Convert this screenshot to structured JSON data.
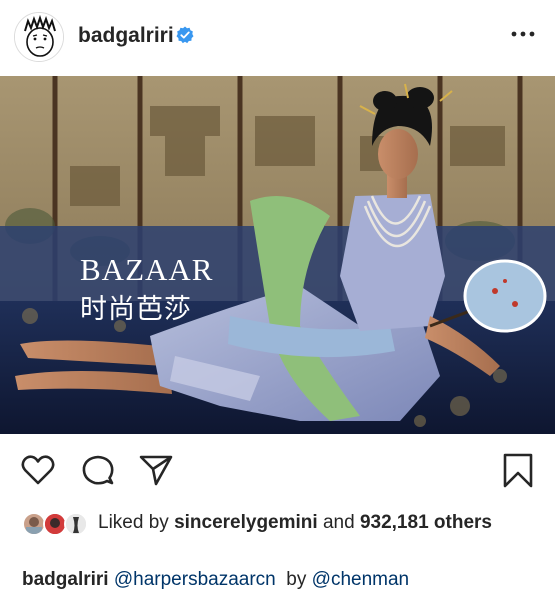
{
  "post": {
    "username": "badgalriri",
    "verified_icon": "verified-badge-icon",
    "more_icon": "more-options-icon"
  },
  "photo": {
    "magazine_latin": "BAZAAR",
    "magazine_chinese": "时尚芭莎"
  },
  "actions": {
    "like_icon": "heart-icon",
    "comment_icon": "comment-icon",
    "share_icon": "share-icon",
    "save_icon": "bookmark-icon"
  },
  "likes": {
    "prefix": "Liked by",
    "liker": "sincerelygemini",
    "conjunction": "and",
    "count": "932,181",
    "suffix": "others"
  },
  "caption": {
    "username": "badgalriri",
    "mention1": "@harpersbazaarcn",
    "by": "by",
    "mention2": "@chenman"
  },
  "colors": {
    "accent_verified": "#3897f0",
    "mention": "#003569",
    "text": "#262626"
  }
}
